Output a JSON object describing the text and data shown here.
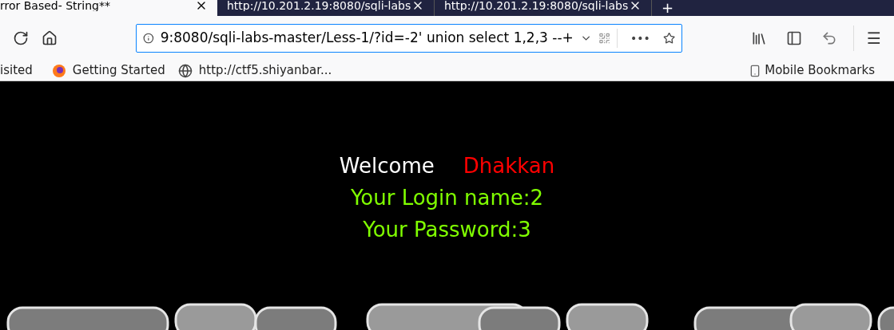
{
  "tabs": [
    {
      "title": "rror Based- String**",
      "selected": true
    },
    {
      "title": "http://10.201.2.19:8080/sqli-labs",
      "selected": false
    },
    {
      "title": "http://10.201.2.19:8080/sqli-labs",
      "selected": false
    }
  ],
  "new_tab": "+",
  "address_bar": {
    "value": "9:8080/sqli-labs-master/Less-1/?id=-2' union select 1,2,3 --+",
    "more": "•••"
  },
  "menu_icon": "☰",
  "bookmarks": [
    {
      "label": "isited",
      "kind": "text"
    },
    {
      "label": "Getting Started",
      "kind": "browser"
    },
    {
      "label": "http://ctf5.shiyanbar...",
      "kind": "globe"
    }
  ],
  "mobile_bookmarks": "Mobile Bookmarks",
  "page": {
    "welcome": "Welcome",
    "user": "Dhakkan",
    "login_name": "Your Login name:2",
    "password": "Your Password:3"
  }
}
